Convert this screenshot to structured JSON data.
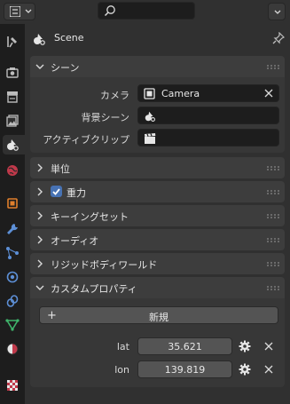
{
  "context": {
    "scene_name": "Scene"
  },
  "scene_panel": {
    "title": "シーン",
    "camera_label": "カメラ",
    "camera_value": "Camera",
    "background_label": "背景シーン",
    "background_value": "",
    "clip_label": "アクティブクリップ",
    "clip_value": ""
  },
  "panels": {
    "units": "単位",
    "gravity": "重力",
    "keying_sets": "キーイングセット",
    "audio": "オーディオ",
    "rigid_body_world": "リジッドボディワールド",
    "custom_properties": "カスタムプロパティ"
  },
  "custom_properties": {
    "new_button": "新規",
    "items": [
      {
        "name": "lat",
        "value": "35.621"
      },
      {
        "name": "lon",
        "value": "139.819"
      }
    ]
  },
  "colors": {
    "accent_blue": "#4772b3",
    "panel_bg": "#303030",
    "field_bg": "#1d1d1d"
  },
  "gravity_enabled": true
}
